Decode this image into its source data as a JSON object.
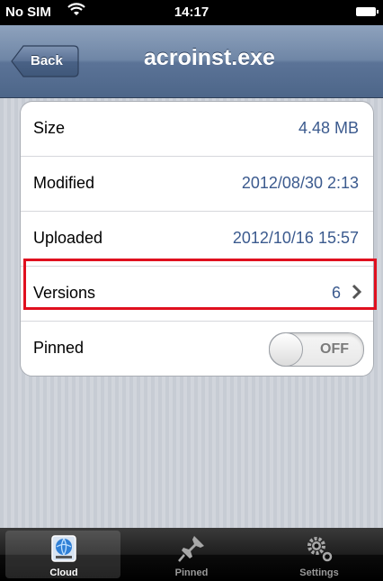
{
  "status_bar": {
    "carrier": "No SIM",
    "time": "14:17"
  },
  "nav": {
    "back_label": "Back",
    "title": "acroinst.exe"
  },
  "details": {
    "size": {
      "label": "Size",
      "value": "4.48 MB"
    },
    "modified": {
      "label": "Modified",
      "value": "2012/08/30 2:13"
    },
    "uploaded": {
      "label": "Uploaded",
      "value": "2012/10/16 15:57"
    },
    "versions": {
      "label": "Versions",
      "value": "6"
    },
    "pinned": {
      "label": "Pinned",
      "toggle_text": "OFF"
    }
  },
  "tabbar": {
    "tabs": [
      {
        "label": "Cloud",
        "icon": "cloud-drive-icon",
        "active": true
      },
      {
        "label": "Pinned",
        "icon": "pushpin-icon",
        "active": false
      },
      {
        "label": "Settings",
        "icon": "gears-icon",
        "active": false
      }
    ]
  },
  "colors": {
    "value_text": "#3b5a8e",
    "highlight": "#e0101f",
    "navbar": "#5b7397"
  }
}
